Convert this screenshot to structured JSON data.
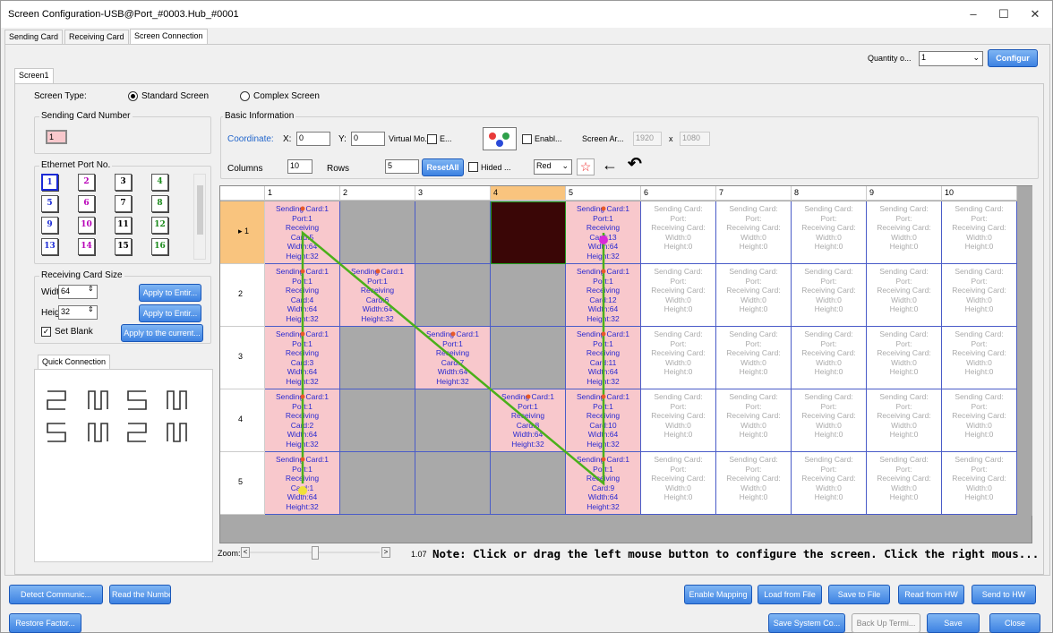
{
  "window": {
    "title": "Screen Configuration-USB@Port_#0003.Hub_#0001",
    "minimize": "–",
    "maximize": "☐",
    "close": "✕"
  },
  "tabs": [
    "Sending Card",
    "Receiving Card",
    "Screen Connection"
  ],
  "screen_tab": "Screen1",
  "quantity": {
    "label": "Quantity o...",
    "value": "1",
    "configure": "Configur"
  },
  "screen_type": {
    "label": "Screen Type:",
    "standard": "Standard Screen",
    "complex": "Complex Screen"
  },
  "sending_card_number": {
    "label": "Sending Card Number",
    "value": "1"
  },
  "ethernet": {
    "label": "Ethernet Port No.",
    "ports": [
      "1",
      "2",
      "3",
      "4",
      "5",
      "6",
      "7",
      "8",
      "9",
      "10",
      "11",
      "12",
      "13",
      "14",
      "15",
      "16"
    ]
  },
  "rc_size": {
    "label": "Receiving Card Size",
    "width_label": "Width:",
    "width": "64",
    "height_label": "Height:",
    "height": "32",
    "apply_entire": "Apply to Entir...",
    "apply_entire2": "Apply to Entir...",
    "set_blank": "Set Blank",
    "apply_current": "Apply to the current..."
  },
  "quick": {
    "label": "Quick Connection"
  },
  "basic": {
    "label": "Basic Information",
    "coordinate": "Coordinate:",
    "x_label": "X:",
    "x": "0",
    "y_label": "Y:",
    "y": "0",
    "virtual": "Virtual Mo...",
    "e": "E...",
    "enable": "Enabl...",
    "screen_area": "Screen Ar...",
    "w": "1920",
    "x_sep": "x",
    "h": "1080",
    "columns_label": "Columns",
    "columns": "10",
    "rows_label": "Rows",
    "rows": "5",
    "reset": "ResetAll",
    "hided": "Hided ...",
    "color": "Red"
  },
  "grid": {
    "col_headers": [
      "1",
      "2",
      "3",
      "4",
      "5",
      "6",
      "7",
      "8",
      "9",
      "10"
    ],
    "row_headers": [
      "1",
      "2",
      "3",
      "4",
      "5"
    ],
    "cells": [
      [
        "Sending Card:1|Port:1|Receiving|Card:5|Width:64|Height:32",
        "",
        "",
        "",
        "Sending Card:1|Port:1|Receiving|Card:13|Width:64|Height:32",
        "Sending Card:|Port:|Receiving Card:|Width:0|Height:0",
        "Sending Card:|Port:|Receiving Card:|Width:0|Height:0",
        "Sending Card:|Port:|Receiving Card:|Width:0|Height:0",
        "Sending Card:|Port:|Receiving Card:|Width:0|Height:0",
        "Sending Card:|Port:|Receiving Card:|Width:0|Height:0"
      ],
      [
        "Sending Card:1|Port:1|Receiving|Card:4|Width:64|Height:32",
        "Sending Card:1|Port:1|Receiving|Card:6|Width:64|Height:32",
        "",
        "",
        "Sending Card:1|Port:1|Receiving|Card:12|Width:64|Height:32",
        "Sending Card:|Port:|Receiving Card:|Width:0|Height:0",
        "Sending Card:|Port:|Receiving Card:|Width:0|Height:0",
        "Sending Card:|Port:|Receiving Card:|Width:0|Height:0",
        "Sending Card:|Port:|Receiving Card:|Width:0|Height:0",
        "Sending Card:|Port:|Receiving Card:|Width:0|Height:0"
      ],
      [
        "Sending Card:1|Port:1|Receiving|Card:3|Width:64|Height:32",
        "",
        "Sending Card:1|Port:1|Receiving|Card:7|Width:64|Height:32",
        "",
        "Sending Card:1|Port:1|Receiving|Card:11|Width:64|Height:32",
        "Sending Card:|Port:|Receiving Card:|Width:0|Height:0",
        "Sending Card:|Port:|Receiving Card:|Width:0|Height:0",
        "Sending Card:|Port:|Receiving Card:|Width:0|Height:0",
        "Sending Card:|Port:|Receiving Card:|Width:0|Height:0",
        "Sending Card:|Port:|Receiving Card:|Width:0|Height:0"
      ],
      [
        "Sending Card:1|Port:1|Receiving|Card:2|Width:64|Height:32",
        "",
        "",
        "Sending Card:1|Port:1|Receiving|Card:8|Width:64|Height:32",
        "Sending Card:1|Port:1|Receiving|Card:10|Width:64|Height:32",
        "Sending Card:|Port:|Receiving Card:|Width:0|Height:0",
        "Sending Card:|Port:|Receiving Card:|Width:0|Height:0",
        "Sending Card:|Port:|Receiving Card:|Width:0|Height:0",
        "Sending Card:|Port:|Receiving Card:|Width:0|Height:0",
        "Sending Card:|Port:|Receiving Card:|Width:0|Height:0"
      ],
      [
        "Sending Card:1|Port:1|Receiving|Card:1|Width:64|Height:32",
        "",
        "",
        "",
        "Sending Card:1|Port:1|Receiving|Card:9|Width:64|Height:32",
        "Sending Card:|Port:|Receiving Card:|Width:0|Height:0",
        "Sending Card:|Port:|Receiving Card:|Width:0|Height:0",
        "Sending Card:|Port:|Receiving Card:|Width:0|Height:0",
        "Sending Card:|Port:|Receiving Card:|Width:0|Height:0",
        "Sending Card:|Port:|Receiving Card:|Width:0|Height:0"
      ]
    ]
  },
  "zoom": {
    "label": "Zoom:",
    "left": "<",
    "right": ">",
    "value": "1.07",
    "note": "Note: Click or drag the left mouse button to configure the screen. Click the right mous..."
  },
  "bottom": {
    "detect": "Detect Communic...",
    "read_number": "Read the Number...",
    "enable_mapping": "Enable Mapping",
    "load": "Load from File",
    "save_file": "Save to File",
    "read_hw": "Read from HW",
    "send_hw": "Send to HW",
    "restore": "Restore Factor...",
    "save_system": "Save System Co...",
    "backup": "Back Up Termi...",
    "save": "Save",
    "close": "Close"
  }
}
